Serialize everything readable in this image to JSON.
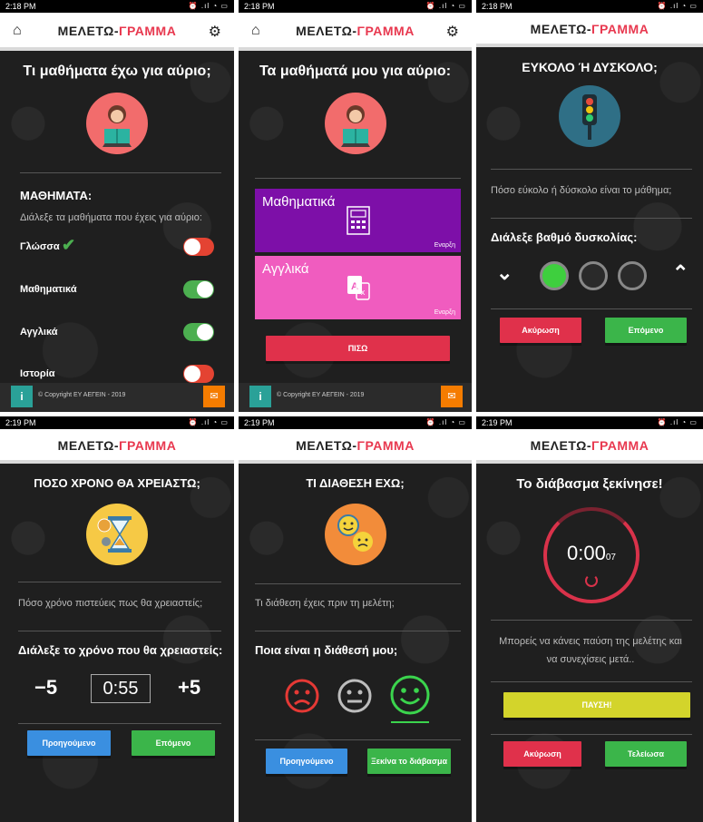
{
  "brand": {
    "part1": "ΜΕΛΕΤΩ-",
    "part2": "ΓΡΑΜΜΑ"
  },
  "statusbar": {
    "t1": "2:18 PM",
    "t2": "2:18 PM",
    "t3": "2:18 PM",
    "t4": "2:19 PM",
    "t5": "2:19 PM",
    "t6": "2:19 PM",
    "sysicons": "⏰ .ıl ◔ ▭"
  },
  "screen1": {
    "title": "Τι μαθήματα έχω για αύριο;",
    "section": "ΜΑΘΗΜΑΤΑ:",
    "subtitle": "Διάλεξε τα μαθήματα που έχεις για αύριο:",
    "subjects": [
      {
        "label": "Γλώσσα",
        "enabled": false
      },
      {
        "label": "Μαθηματικά",
        "enabled": true
      },
      {
        "label": "Αγγλικά",
        "enabled": true
      },
      {
        "label": "Ιστορία",
        "enabled": false
      }
    ],
    "footer_copyright": "© Copyright ΕΥ ΑΕΓΕΙΝ - 2019"
  },
  "screen2": {
    "title": "Τα μαθήματά μου για αύριο:",
    "cards": [
      {
        "label": "Μαθηματικά",
        "status": "Εναρξη",
        "color": "#7d0fa8"
      },
      {
        "label": "Αγγλικά",
        "status": "Εναρξη",
        "color": "#f05cbf"
      }
    ],
    "back_button": "ΠΙΣΩ",
    "footer_copyright": "© Copyright ΕΥ ΑΕΓΕΙΝ - 2019"
  },
  "screen3": {
    "title": "ΕΥΚΟΛΟ Ή ΔΥΣΚΟΛΟ;",
    "question": "Πόσο εύκολο ή δύσκολο είναι το μάθημα;",
    "prompt": "Διάλεξε βαθμό δυσκολίας:",
    "difficulty_selected": 1,
    "difficulty_max": 3,
    "cancel_button": "Ακύρωση",
    "next_button": "Επόμενο"
  },
  "screen4": {
    "title": "ΠΟΣΟ ΧΡΟΝΟ ΘΑ ΧΡΕΙΑΣΤΩ;",
    "question": "Πόσο χρόνο πιστεύεις πως θα χρειαστείς;",
    "prompt": "Διάλεξε το χρόνο που θα χρειαστείς:",
    "minus_label": "−5",
    "time_value": "0:55",
    "plus_label": "+5",
    "prev_button": "Προηγούμενο",
    "next_button": "Επόμενο"
  },
  "screen5": {
    "title": "ΤΙ ΔΙΑΘΕΣΗ ΕΧΩ;",
    "question": "Τι διάθεση έχεις πριν τη μελέτη;",
    "prompt": "Ποια είναι η διάθεσή μου;",
    "selected_mood": "happy",
    "prev_button": "Προηγούμενο",
    "start_button": "Ξεκίνα το διάβασμα"
  },
  "screen6": {
    "title": "Το διάβασμα ξεκίνησε!",
    "timer_main": "0:00",
    "timer_sub": "07",
    "info_line1": "Μπορείς να κάνεις παύση της μελέτης και",
    "info_line2": "να συνεχίσεις μετά..",
    "pause_button": "ΠΑΥΣΗ!",
    "cancel_button": "Ακύρωση",
    "done_button": "Τελείωσα"
  },
  "colors": {
    "accent_red": "#e0314b",
    "green": "#3bb54a",
    "blue": "#3a8fe0",
    "yellow": "#d3d42b"
  }
}
